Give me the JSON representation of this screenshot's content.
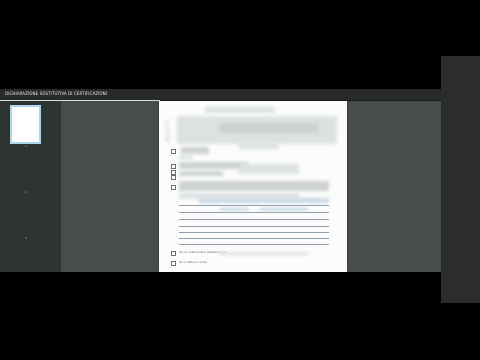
{
  "viewer": {
    "title": "DICHIARAZIONE SOSTITUTIVA DI CERTIFICAZIONI"
  },
  "thumbnails": [
    {
      "number": "1",
      "selected": true
    },
    {
      "number": "2",
      "selected": false
    },
    {
      "number": "3",
      "selected": false
    }
  ],
  "document": {
    "check_label_1": "da cui risulta proprio (visibile) al n.ro",
    "check_label_2": "da cui fatturo e come"
  },
  "colors": {
    "selection": "#a9d6ea",
    "viewer_background": "#4b514f",
    "sidebar_background": "#2e3432"
  }
}
